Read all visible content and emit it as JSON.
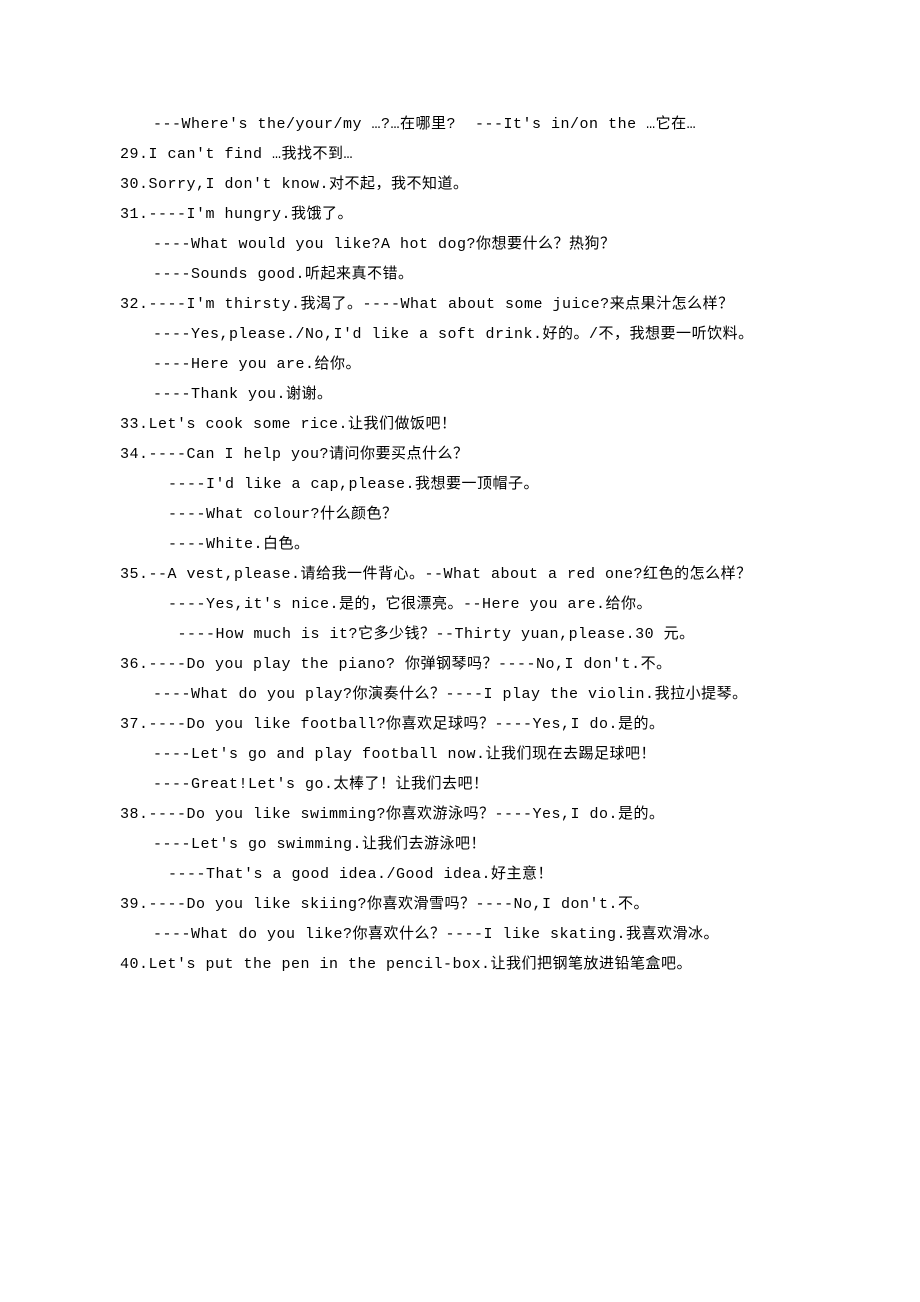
{
  "lines": [
    {
      "cls": "indent1",
      "text": "---Where's the/your/my …?…在哪里?  ---It's in/on the …它在…"
    },
    {
      "cls": "",
      "text": "29.I can't find …我找不到…"
    },
    {
      "cls": "",
      "text": "30.Sorry,I don't know.对不起，我不知道。"
    },
    {
      "cls": "",
      "text": "31.----I'm hungry.我饿了。"
    },
    {
      "cls": "indent1",
      "text": "----What would you like?A hot dog?你想要什么？热狗？"
    },
    {
      "cls": "indent1",
      "text": "----Sounds good.听起来真不错。"
    },
    {
      "cls": "",
      "text": "32.----I'm thirsty.我渴了。----What about some juice?来点果汁怎么样？"
    },
    {
      "cls": "indent1",
      "text": "----Yes,please./No,I'd like a soft drink.好的。/不，我想要一听饮料。"
    },
    {
      "cls": "indent1",
      "text": "----Here you are.给你。"
    },
    {
      "cls": "indent1",
      "text": "----Thank you.谢谢。"
    },
    {
      "cls": "",
      "text": "33.Let's cook some rice.让我们做饭吧！"
    },
    {
      "cls": "",
      "text": "34.----Can I help you?请问你要买点什么？"
    },
    {
      "cls": "indent2",
      "text": "----I'd like a cap,please.我想要一顶帽子。"
    },
    {
      "cls": "indent2",
      "text": "----What colour?什么颜色？"
    },
    {
      "cls": "indent2",
      "text": "----White.白色。"
    },
    {
      "cls": "",
      "text": "35.--A vest,please.请给我一件背心。--What about a red one?红色的怎么样？"
    },
    {
      "cls": "indent2",
      "text": "----Yes,it's nice.是的，它很漂亮。--Here you are.给你。"
    },
    {
      "cls": "indent2",
      "text": " ----How much is it?它多少钱？--Thirty yuan,please.30 元。"
    },
    {
      "cls": "",
      "text": "36.----Do you play the piano? 你弹钢琴吗？----No,I don't.不。"
    },
    {
      "cls": "indent1",
      "text": "----What do you play?你演奏什么？----I play the violin.我拉小提琴。"
    },
    {
      "cls": "",
      "text": "37.----Do you like football?你喜欢足球吗？----Yes,I do.是的。"
    },
    {
      "cls": "indent1",
      "text": "----Let's go and play football now.让我们现在去踢足球吧！"
    },
    {
      "cls": "indent1",
      "text": "----Great!Let's go.太棒了！让我们去吧！"
    },
    {
      "cls": "",
      "text": "38.----Do you like swimming?你喜欢游泳吗？----Yes,I do.是的。"
    },
    {
      "cls": "indent1",
      "text": "----Let's go swimming.让我们去游泳吧！"
    },
    {
      "cls": "indent2",
      "text": "----That's a good idea./Good idea.好主意！"
    },
    {
      "cls": "",
      "text": "39.----Do you like skiing?你喜欢滑雪吗？----No,I don't.不。"
    },
    {
      "cls": "indent1",
      "text": "----What do you like?你喜欢什么？----I like skating.我喜欢滑冰。"
    },
    {
      "cls": "",
      "text": "40.Let's put the pen in the pencil-box.让我们把钢笔放进铅笔盒吧。"
    }
  ]
}
